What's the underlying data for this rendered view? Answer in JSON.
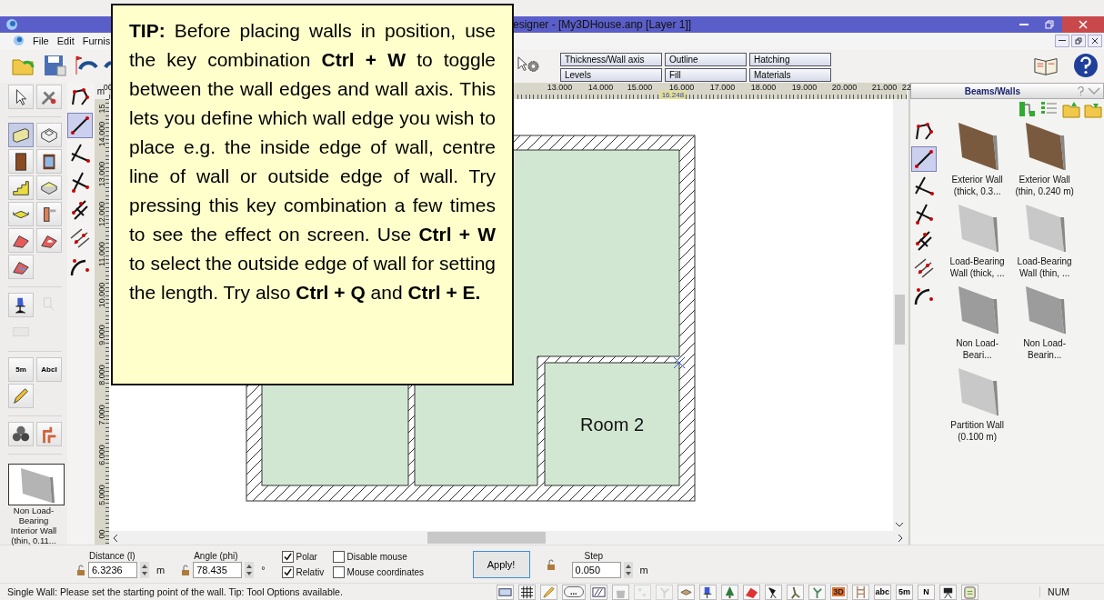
{
  "window": {
    "title": "esigner - [My3DHouse.anp [Layer 1]]"
  },
  "menu": [
    "File",
    "Edit",
    "Furnis"
  ],
  "property_tabs": [
    {
      "label": "Thickness/Wall axis"
    },
    {
      "label": "Outline"
    },
    {
      "label": "Hatching"
    },
    {
      "label": "Levels"
    },
    {
      "label": "Fill"
    },
    {
      "label": "Materials"
    }
  ],
  "palette_groups": [
    {
      "items": [
        {
          "kind": "pointer",
          "selected": false,
          "disabled": false
        },
        {
          "kind": "tools",
          "selected": false,
          "disabled": false
        }
      ]
    },
    {
      "items": [
        {
          "kind": "wall",
          "selected": true,
          "disabled": false
        },
        {
          "kind": "room",
          "selected": false,
          "disabled": false
        },
        {
          "kind": "door",
          "selected": false,
          "disabled": false
        },
        {
          "kind": "window",
          "selected": false,
          "disabled": false
        },
        {
          "kind": "stairs",
          "selected": false,
          "disabled": false
        },
        {
          "kind": "slab",
          "selected": false,
          "disabled": false
        },
        {
          "kind": "ceiling",
          "selected": false,
          "disabled": false
        },
        {
          "kind": "column",
          "selected": false,
          "disabled": false
        },
        {
          "kind": "roof",
          "selected": false,
          "disabled": false
        },
        {
          "kind": "roof-window",
          "selected": false,
          "disabled": false
        },
        {
          "kind": "dormer",
          "selected": false,
          "disabled": false
        }
      ]
    },
    {
      "items": [
        {
          "kind": "chair",
          "selected": false,
          "disabled": false
        },
        {
          "kind": "lamp",
          "selected": false,
          "disabled": true
        },
        {
          "kind": "panel",
          "selected": false,
          "disabled": true
        }
      ]
    },
    {
      "items": [
        {
          "kind": "dimension",
          "label": "5m",
          "selected": false,
          "disabled": false
        },
        {
          "kind": "text",
          "label": "AbcI",
          "selected": false,
          "disabled": false
        },
        {
          "kind": "pencil",
          "selected": false,
          "disabled": false
        }
      ]
    },
    {
      "items": [
        {
          "kind": "spiral",
          "selected": false,
          "disabled": false
        },
        {
          "kind": "pipes",
          "selected": false,
          "disabled": false
        }
      ]
    }
  ],
  "preview": {
    "caption": "Non Load-Bearing Interior Wall (thin, 0.11..."
  },
  "wall_tools": [
    {
      "kind": "polyline",
      "selected": false
    },
    {
      "kind": "single",
      "selected": true
    },
    {
      "kind": "angle",
      "selected": false
    },
    {
      "kind": "right-angle",
      "selected": false
    },
    {
      "kind": "parallel",
      "selected": false
    },
    {
      "kind": "offset",
      "selected": false
    },
    {
      "kind": "arc",
      "selected": false
    }
  ],
  "ruler_top": {
    "labels": [
      "00",
      "13.000",
      "14.000",
      "15.000",
      "16.000",
      "17.000",
      "18.000",
      "19.000",
      "20.000",
      "21.000",
      "22"
    ],
    "cursor": "16.248"
  },
  "ruler_left": {
    "unit": "m",
    "labels": [
      "15",
      "14.000",
      "13.000",
      "12.000",
      "11.000",
      "10.000",
      "9.000",
      "8.000",
      "7.000",
      "6.000",
      "5.000",
      "00"
    ]
  },
  "plan": {
    "rooms": [
      {
        "kind": "l-shape"
      },
      {
        "kind": "left"
      },
      {
        "kind": "right",
        "label": "Room 2"
      }
    ]
  },
  "tip": {
    "text": "**TIP:** Before placing walls in position, use the key combination **Ctrl + W** to toggle between the wall edges and wall axis. This lets you define which wall edge you wish to place e.g. the inside edge of wall, centre line of wall or outside edge of wall. Try pressing this key combination a few times to see the effect on screen. Use **Ctrl + W** to select the outside edge of wall for setting the length. Try also **Ctrl + Q** and **Ctrl + E.**"
  },
  "panel": {
    "title": "Beams/Walls",
    "tools": [
      {
        "kind": "polyline",
        "selected": false
      },
      {
        "kind": "single",
        "selected": true
      },
      {
        "kind": "angle",
        "selected": false
      },
      {
        "kind": "right-angle",
        "selected": false
      },
      {
        "kind": "parallel",
        "selected": false
      },
      {
        "kind": "offset",
        "selected": false
      },
      {
        "kind": "arc",
        "selected": false
      }
    ],
    "items": [
      {
        "kind": "brick",
        "caption": "Exterior Wall (thick, 0.3..."
      },
      {
        "kind": "brick",
        "caption": "Exterior Wall (thin, 0.240 m)"
      },
      {
        "kind": "light",
        "caption": "Load-Bearing Wall (thick, ..."
      },
      {
        "kind": "light",
        "caption": "Load-Bearing Wall (thin, ..."
      },
      {
        "kind": "grey",
        "caption": "Non Load-Beari..."
      },
      {
        "kind": "grey",
        "caption": "Non Load-Bearin..."
      },
      {
        "kind": "light",
        "caption": "Partition Wall (0.100 m)"
      }
    ]
  },
  "options": {
    "distance": {
      "label": "Distance (l)",
      "value": "6.3236",
      "unit": "m"
    },
    "angle": {
      "label": "Angle (phi)",
      "value": "78.435",
      "unit": "°"
    },
    "checks": [
      {
        "label": "Polar",
        "checked": true
      },
      {
        "label": "Relativ",
        "checked": true
      },
      {
        "label": "Disable mouse",
        "checked": false
      },
      {
        "label": "Mouse coordinates",
        "checked": false
      }
    ],
    "apply": "Apply!",
    "step": {
      "label": "Step",
      "value": "0.050",
      "unit": "m"
    }
  },
  "status_bar": {
    "message": "Single Wall: Please set the starting point of the wall. Tip: Tool Options available.",
    "tools": [
      {
        "kind": "wall-view",
        "disabled": false
      },
      {
        "kind": "grid",
        "disabled": false
      },
      {
        "kind": "pencil",
        "disabled": false
      },
      {
        "kind": "pill",
        "label": "...",
        "disabled": false
      },
      {
        "kind": "hatch",
        "disabled": false
      },
      {
        "kind": "bag",
        "disabled": false
      },
      {
        "kind": "steps",
        "disabled": true
      },
      {
        "kind": "plant",
        "disabled": true
      },
      {
        "kind": "box",
        "disabled": false
      },
      {
        "kind": "chair",
        "disabled": false
      },
      {
        "kind": "tree",
        "disabled": false
      },
      {
        "kind": "roof",
        "disabled": false
      },
      {
        "kind": "spot",
        "disabled": false
      },
      {
        "kind": "figure",
        "disabled": false
      },
      {
        "kind": "plant",
        "disabled": false
      },
      {
        "kind": "cube",
        "label": "3D",
        "disabled": false
      },
      {
        "kind": "ladder",
        "disabled": false
      },
      {
        "kind": "text",
        "label": "abc",
        "disabled": false
      },
      {
        "kind": "dimension",
        "label": "5m",
        "disabled": false
      },
      {
        "kind": "north",
        "label": "N",
        "disabled": false
      },
      {
        "kind": "camera",
        "disabled": false
      },
      {
        "kind": "clipboard",
        "disabled": false
      }
    ],
    "indicator": "NUM"
  }
}
